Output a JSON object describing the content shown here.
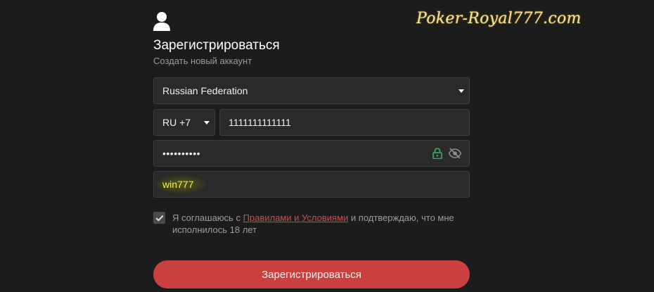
{
  "watermark": "Poker-Royal777.com",
  "header": {
    "icon": "user-icon",
    "title": "Зарегистрироваться",
    "subtitle": "Создать новый аккаунт"
  },
  "form": {
    "country": {
      "value": "Russian Federation",
      "icon": "caret-down-icon"
    },
    "phone_code": {
      "value": "RU +7",
      "icon": "caret-down-icon"
    },
    "phone": {
      "value": "1111111111111"
    },
    "password": {
      "value": "••••••••••",
      "icons": [
        "lock-icon",
        "eye-slash-icon"
      ]
    },
    "promo": {
      "value": "win777"
    },
    "agree": {
      "checked": true,
      "text_before": "Я соглашаюсь с ",
      "link": "Правилами и Условиями",
      "text_after": " и подтверждаю, что мне исполнилось 18 лет"
    },
    "submit_label": "Зарегистрироваться"
  },
  "colors": {
    "background": "#1c1c1c",
    "field": "#2a2a2a",
    "accent": "#c9403e",
    "lock_green": "#34a853",
    "promo_text": "#f2f24a"
  }
}
